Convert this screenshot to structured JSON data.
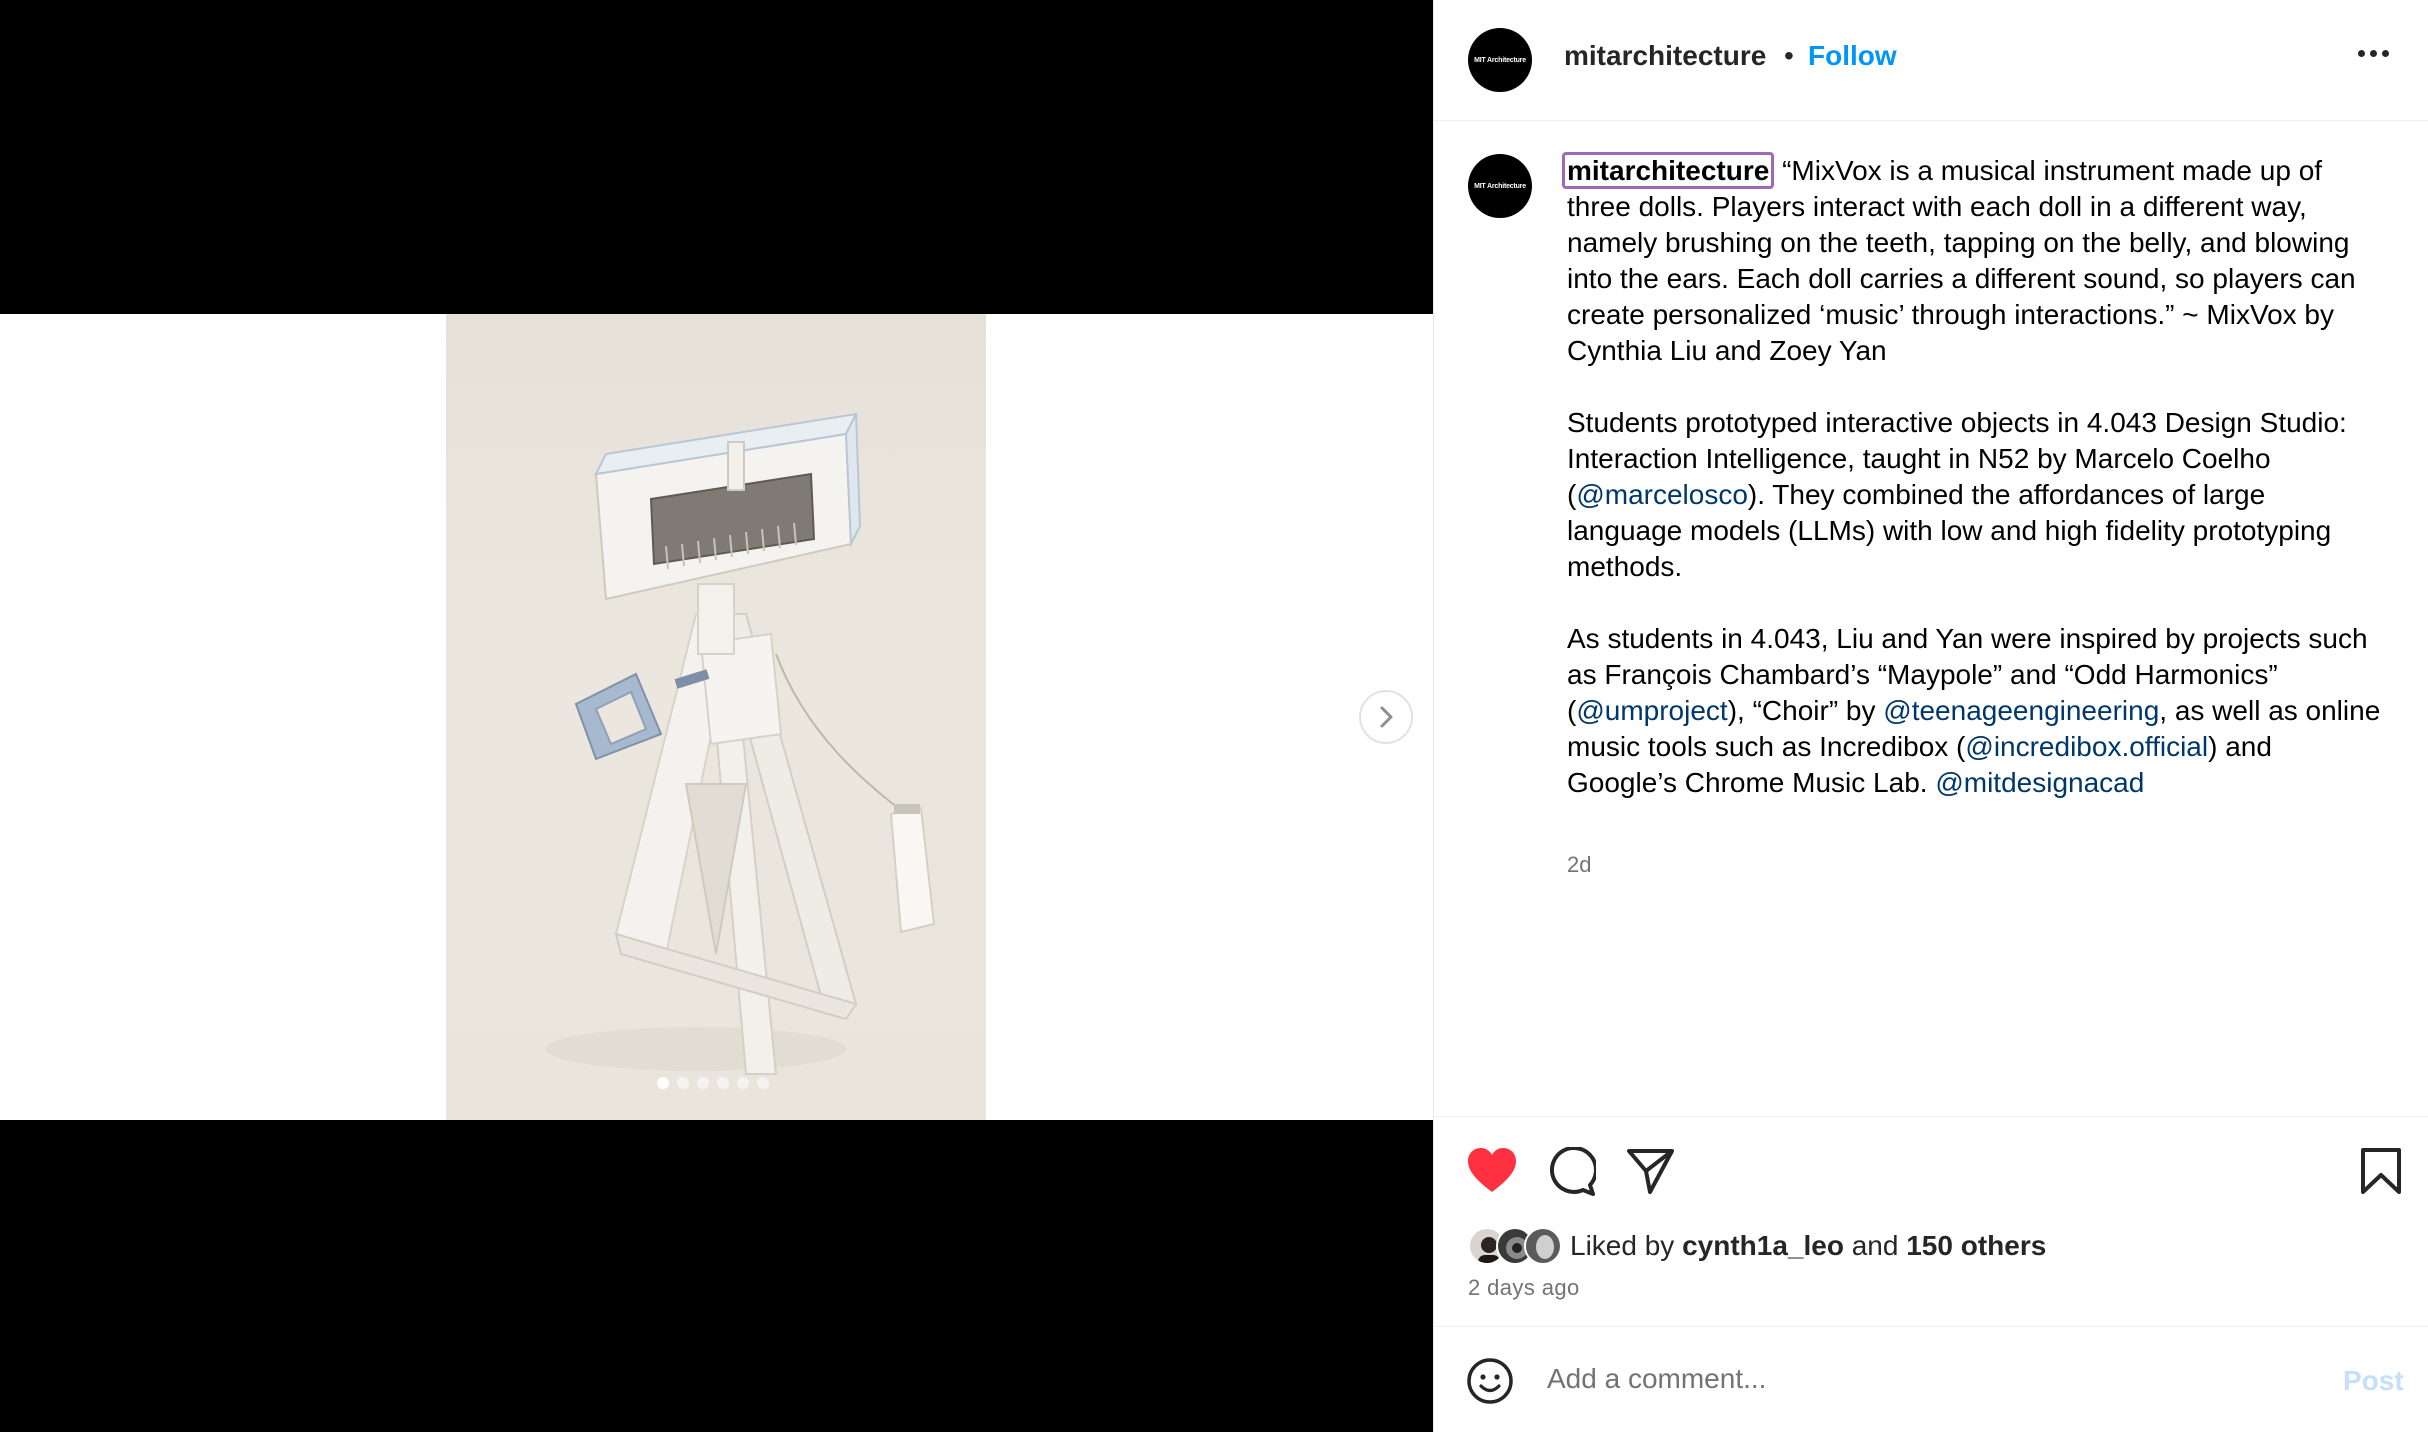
{
  "post": {
    "carousel": {
      "slide_count": 6,
      "active_index": 0
    }
  },
  "header": {
    "avatar_text": "MIT Architecture",
    "username": "mitarchitecture",
    "separator": "•",
    "follow_label": "Follow"
  },
  "caption": {
    "avatar_text": "MIT Architecture",
    "username": "mitarchitecture",
    "p1": "“MixVox is a musical instrument made up of three dolls. Players interact with each doll in a different way, namely brushing on the teeth, tapping on the belly, and blowing into the ears. Each doll carries a different sound, so players can create personalized ‘music’ through interactions.” ~ MixVox by Cynthia Liu and Zoey Yan",
    "p2_a": "Students prototyped interactive objects in 4.043 Design Studio: Interaction Intelligence, taught in N52 by Marcelo Coelho (",
    "p2_mention": "@marcelosco",
    "p2_b": "). They combined the affordances of large language models (LLMs) with low and high fidelity prototyping methods.",
    "p3_a": "As students in 4.043, Liu and Yan were inspired by projects such as François Chambard’s “Maypole” and “Odd Harmonics” (",
    "p3_mention1": "@umproject",
    "p3_b": "), “Choir” by ",
    "p3_mention2": "@teenageengineering",
    "p3_c": ", as well as online music tools such as Incredibox (",
    "p3_mention3": "@incredibox.official",
    "p3_d": ") and Google’s Chrome Music Lab. ",
    "p3_mention4": "@mitdesignacad",
    "time_ago": "2d"
  },
  "actions": {
    "liked": true,
    "liked_by_prefix": "Liked by ",
    "liked_by_user": "cynth1a_leo",
    "liked_by_and": " and ",
    "liked_by_others": "150 others",
    "date": "2 days ago"
  },
  "comment": {
    "placeholder": "Add a comment...",
    "post_label": "Post"
  },
  "icons": {
    "like": "heart-icon",
    "comment": "comment-icon",
    "share": "share-icon",
    "save": "bookmark-icon",
    "emoji": "emoji-icon",
    "more": "more-options-icon",
    "next": "chevron-right-icon"
  },
  "colors": {
    "link": "#0095f6",
    "mention": "#00376b",
    "like": "#ff3040",
    "post_disabled": "#c4e0fb"
  }
}
